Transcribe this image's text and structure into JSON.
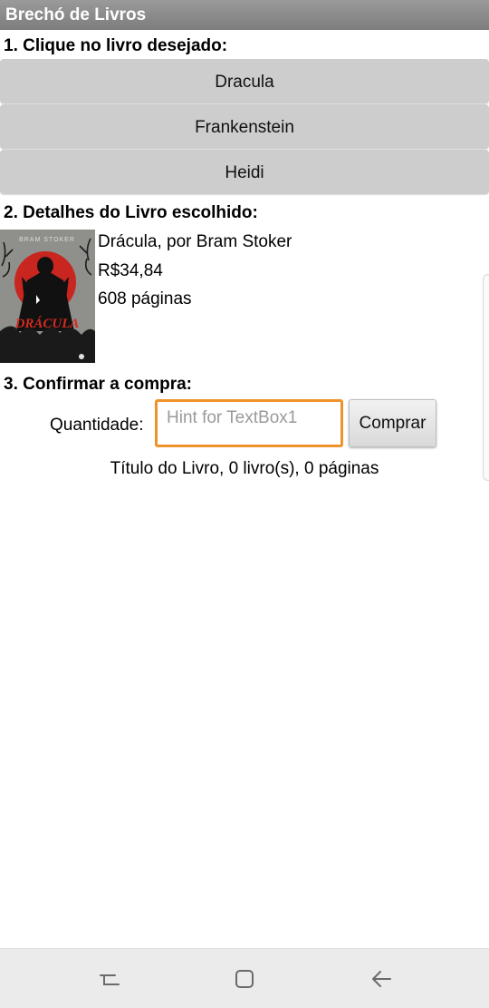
{
  "app": {
    "title": "Brechó de Livros"
  },
  "section1": {
    "heading": "1. Clique no livro desejado:",
    "books": [
      {
        "label": "Dracula"
      },
      {
        "label": "Frankenstein"
      },
      {
        "label": "Heidi"
      }
    ]
  },
  "section2": {
    "heading": "2. Detalhes do Livro escolhido:",
    "cover": {
      "author_text": "BRAM STOKER",
      "title_text": "DRÁCULA"
    },
    "title_author": "Drácula, por Bram Stoker",
    "price": "R$34,84",
    "pages": "608 páginas"
  },
  "section3": {
    "heading": "3. Confirmar a compra:",
    "quantity_label": "Quantidade:",
    "quantity_value": "",
    "quantity_placeholder": "Hint for TextBox1",
    "buy_label": "Comprar",
    "summary": "Título do Livro, 0 livro(s), 0 páginas"
  },
  "navbar": {
    "icons": [
      "recent-apps-icon",
      "home-icon",
      "back-icon"
    ]
  },
  "colors": {
    "titlebar": "#8a8a8a",
    "book_button": "#cdcdcd",
    "input_focus": "#f0922a"
  }
}
